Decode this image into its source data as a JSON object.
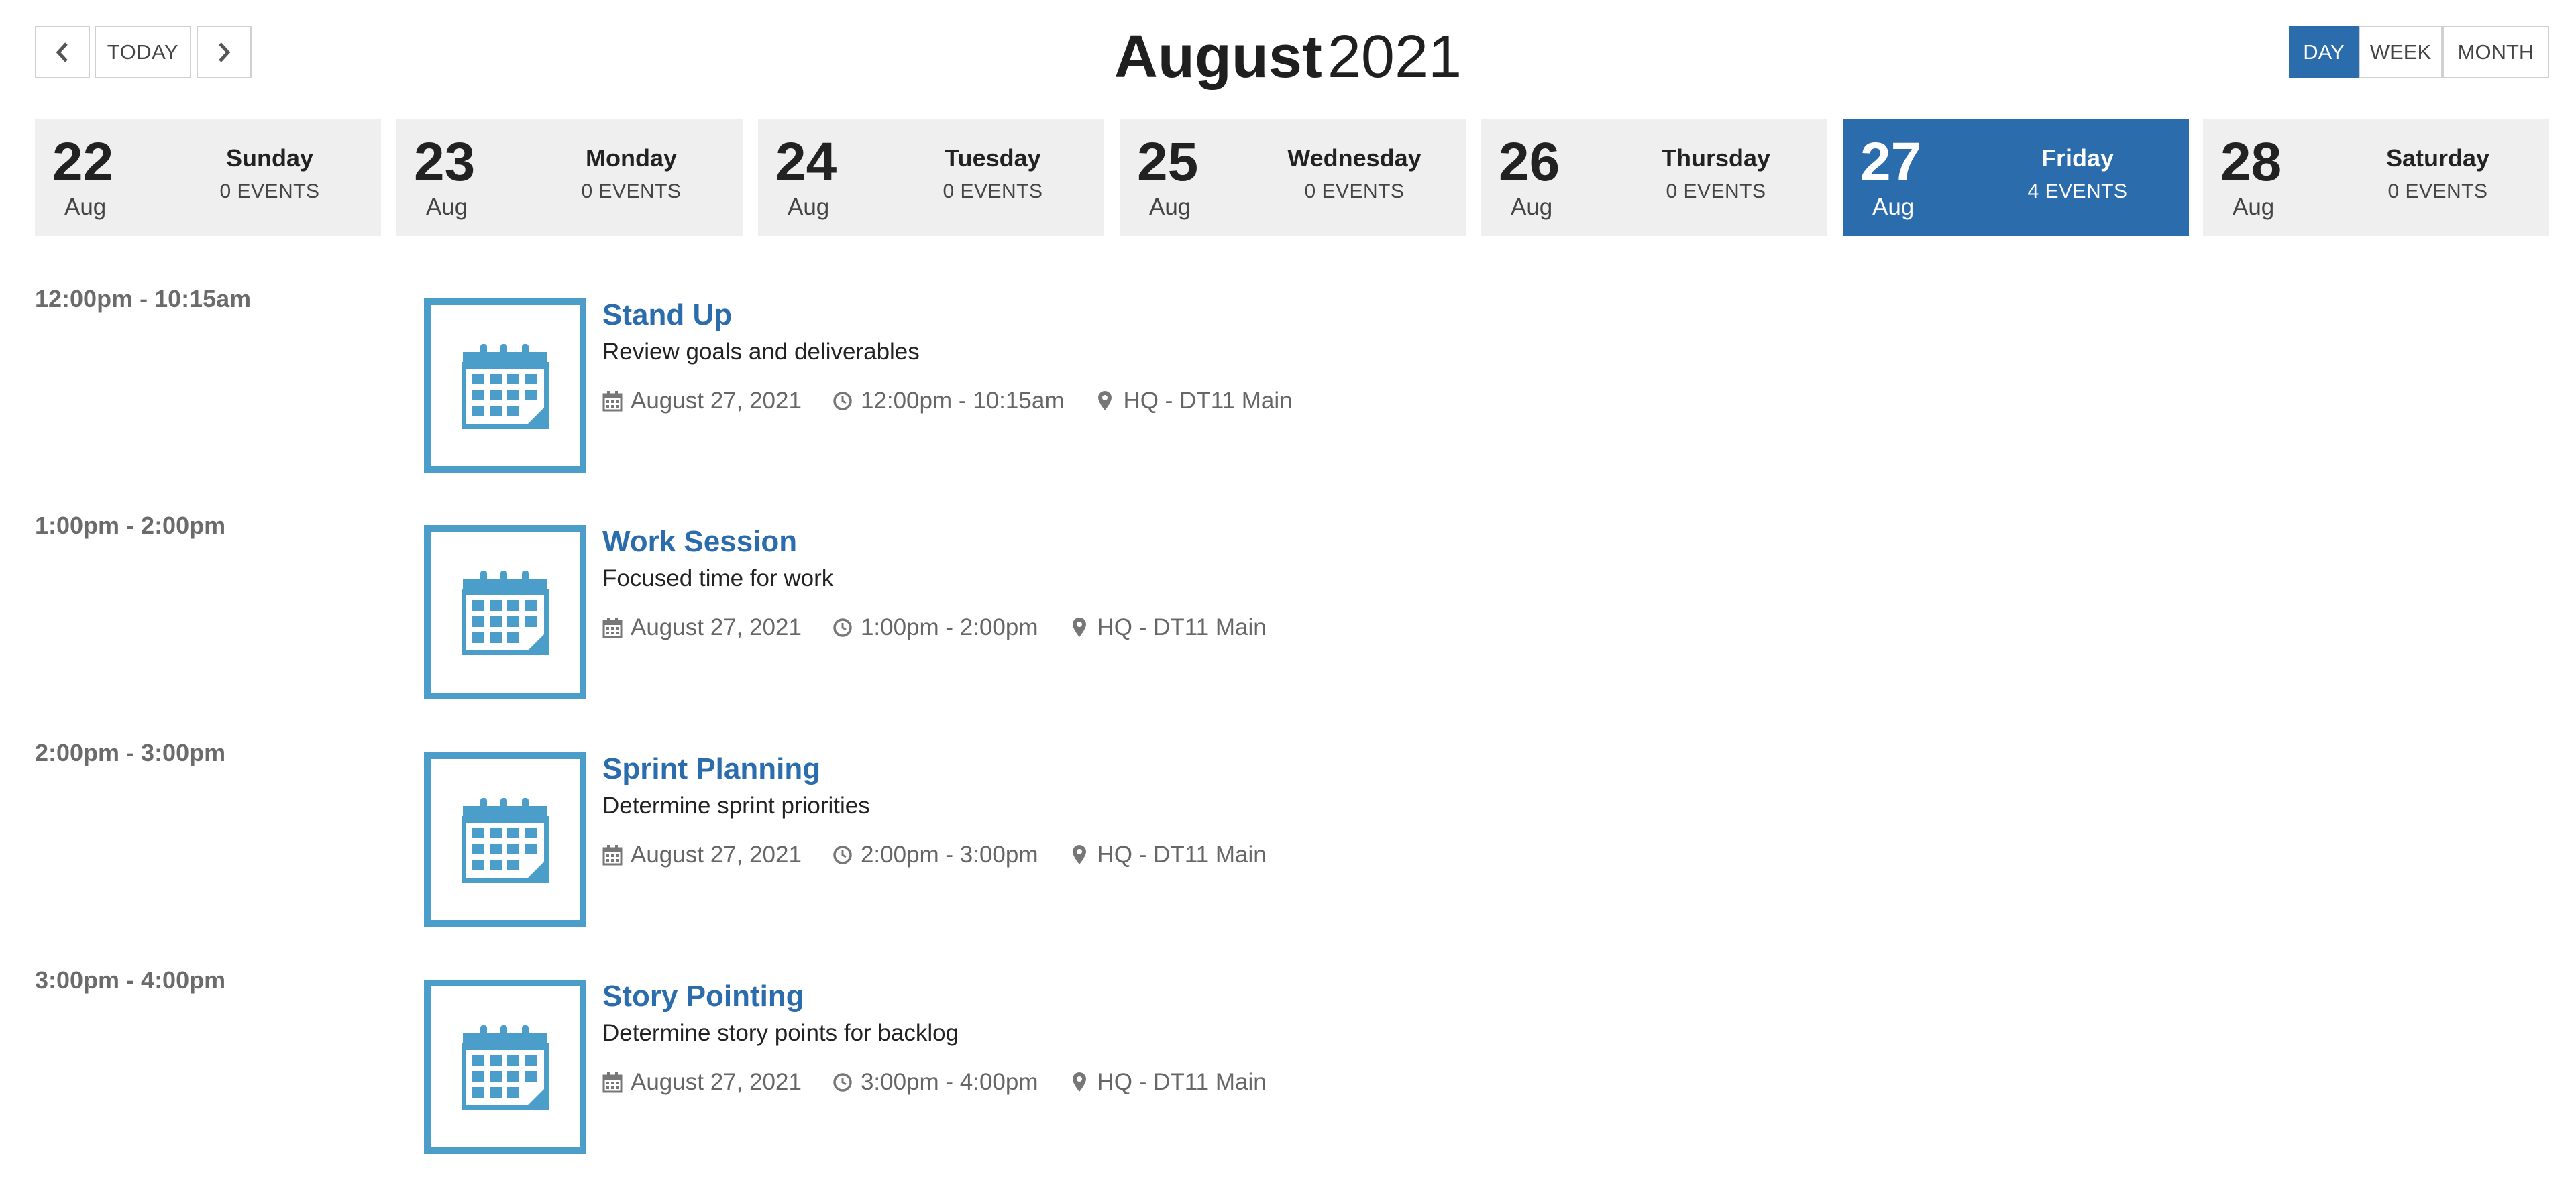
{
  "header": {
    "today_label": "TODAY",
    "title_month": "August",
    "title_year": "2021",
    "views": {
      "day": "DAY",
      "week": "WEEK",
      "month": "MONTH"
    },
    "active_view": "DAY"
  },
  "days": [
    {
      "num": "22",
      "mon": "Aug",
      "weekday": "Sunday",
      "count": "0 EVENTS"
    },
    {
      "num": "23",
      "mon": "Aug",
      "weekday": "Monday",
      "count": "0 EVENTS"
    },
    {
      "num": "24",
      "mon": "Aug",
      "weekday": "Tuesday",
      "count": "0 EVENTS"
    },
    {
      "num": "25",
      "mon": "Aug",
      "weekday": "Wednesday",
      "count": "0 EVENTS"
    },
    {
      "num": "26",
      "mon": "Aug",
      "weekday": "Thursday",
      "count": "0 EVENTS"
    },
    {
      "num": "27",
      "mon": "Aug",
      "weekday": "Friday",
      "count": "4 EVENTS"
    },
    {
      "num": "28",
      "mon": "Aug",
      "weekday": "Saturday",
      "count": "0 EVENTS"
    }
  ],
  "selected_day": "27",
  "events": [
    {
      "time": "12:00pm - 10:15am",
      "title": "Stand Up",
      "desc": "Review goals and deliverables",
      "date": "August 27, 2021",
      "range": "12:00pm - 10:15am",
      "location": "HQ - DT11 Main"
    },
    {
      "time": "1:00pm - 2:00pm",
      "title": "Work Session",
      "desc": "Focused time for work",
      "date": "August 27, 2021",
      "range": "1:00pm - 2:00pm",
      "location": "HQ - DT11 Main"
    },
    {
      "time": "2:00pm - 3:00pm",
      "title": "Sprint Planning",
      "desc": "Determine sprint priorities",
      "date": "August 27, 2021",
      "range": "2:00pm - 3:00pm",
      "location": "HQ - DT11 Main"
    },
    {
      "time": "3:00pm - 4:00pm",
      "title": "Story Pointing",
      "desc": "Determine story points for backlog",
      "date": "August 27, 2021",
      "range": "3:00pm - 4:00pm",
      "location": "HQ - DT11 Main"
    }
  ],
  "icons": {
    "prev": "chevron-left-icon",
    "next": "chevron-right-icon",
    "event": "calendar-icon",
    "date": "calendar-small-icon",
    "time": "clock-icon",
    "location": "map-pin-icon"
  },
  "colors": {
    "accent": "#2b6cad",
    "icon": "#4a9ec9",
    "card": "#efefef"
  }
}
